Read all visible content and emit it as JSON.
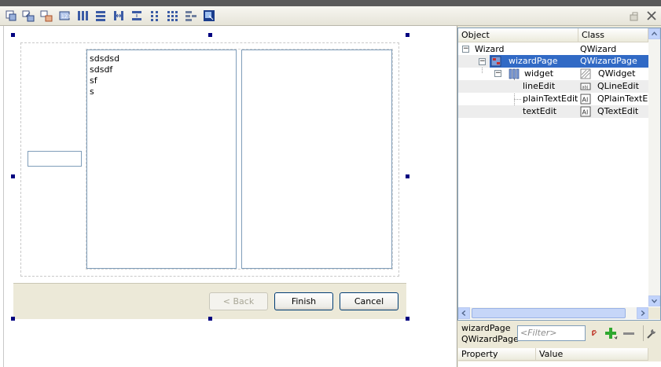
{
  "toolbar": {
    "icons": [
      "edit-widgets-icon",
      "edit-signals-icon",
      "edit-buddies-icon",
      "edit-tab-order-icon",
      "layout-horizontal-icon",
      "layout-vertical-icon",
      "layout-horizontal-splitter-icon",
      "layout-vertical-splitter-icon",
      "layout-form-icon",
      "layout-grid-icon",
      "break-layout-icon",
      "adjust-size-icon"
    ],
    "window_icons": [
      "float-icon",
      "close-icon"
    ]
  },
  "form": {
    "plain_text_lines": [
      "sdsdsd",
      "sdsdf",
      "sf",
      "s"
    ],
    "buttons": {
      "back": "< Back",
      "finish": "Finish",
      "cancel": "Cancel"
    }
  },
  "object_inspector": {
    "columns": [
      "Object",
      "Class"
    ],
    "rows": [
      {
        "object": "Wizard",
        "class": "QWizard"
      },
      {
        "object": "wizardPage",
        "class": "QWizardPage"
      },
      {
        "object": "widget",
        "class": "QWidget"
      },
      {
        "object": "lineEdit",
        "class": "QLineEdit"
      },
      {
        "object": "plainTextEdit",
        "class": "QPlainTextEdit"
      },
      {
        "object": "textEdit",
        "class": "QTextEdit"
      }
    ]
  },
  "property_editor": {
    "object_name": "wizardPage",
    "class_name": "QWizardPage",
    "filter_placeholder": "<Filter>",
    "columns": [
      "Property",
      "Value"
    ]
  },
  "colors": {
    "selection": "#316ac5",
    "handle": "#000080",
    "panel": "#ece9d8"
  }
}
